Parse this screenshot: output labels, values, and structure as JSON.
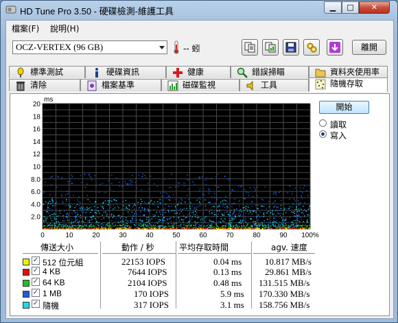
{
  "window": {
    "title": "HD Tune Pro 3.50 - 硬碟檢測-維護工具"
  },
  "menu": [
    {
      "label": "檔案(F)"
    },
    {
      "label": "說明(H)"
    }
  ],
  "toolbar": {
    "drive": "OCZ-VERTEX (96 GB)",
    "temperature": "-- 蚓",
    "exit_label": "離開",
    "buttons": [
      "copy-text-icon",
      "copy-image-icon",
      "save-icon",
      "options-icon",
      "download-icon"
    ]
  },
  "tabs_row1": [
    {
      "label": "標準測試",
      "icon": "benchmark-icon"
    },
    {
      "label": "硬碟資訊",
      "icon": "info-icon"
    },
    {
      "label": "健康",
      "icon": "health-icon"
    },
    {
      "label": "錯誤掃瞄",
      "icon": "error-scan-icon"
    },
    {
      "label": "資料夾使用率",
      "icon": "folder-icon"
    }
  ],
  "tabs_row2": [
    {
      "label": "清除",
      "icon": "erase-icon"
    },
    {
      "label": "檔案基準",
      "icon": "file-benchmark-icon"
    },
    {
      "label": "磁碟監視",
      "icon": "disk-monitor-icon"
    },
    {
      "label": "工具",
      "icon": "tools-icon"
    },
    {
      "label": "隨機存取",
      "icon": "random-access-icon",
      "active": true
    }
  ],
  "controls": {
    "start_label": "開始",
    "read_label": "讀取",
    "write_label": "寫入",
    "mode_selected": "write"
  },
  "chart_data": {
    "type": "scatter",
    "ylabel": "ms",
    "xlabel": "",
    "ylim": [
      0,
      20
    ],
    "xlim": [
      0,
      100
    ],
    "yticks": [
      2.0,
      4.0,
      6.0,
      8.0,
      10,
      12,
      14,
      16,
      18,
      20
    ],
    "xticks": [
      "0",
      "10",
      "20",
      "30",
      "40",
      "50",
      "60",
      "70",
      "80",
      "90",
      "100%"
    ],
    "grid": true,
    "background": "#000000",
    "series": [
      {
        "name": "512 位元組",
        "color": "#f0f000",
        "approx_latency_ms": 0.04
      },
      {
        "name": "4 KB",
        "color": "#e01010",
        "approx_latency_ms": 0.13
      },
      {
        "name": "64 KB",
        "color": "#20c020",
        "approx_latency_ms": 0.48
      },
      {
        "name": "1 MB",
        "color": "#1e5fd8",
        "approx_latency_ms": 5.9
      },
      {
        "name": "隨機",
        "color": "#20d8e8",
        "approx_latency_ms": 3.1
      }
    ]
  },
  "table": {
    "headers": [
      "傳送大小",
      "動作 / 秒",
      "平均存取時間",
      "agv. 速度"
    ],
    "rows": [
      {
        "size": "512 位元組",
        "iops": "22153 IOPS",
        "access": "0.04 ms",
        "speed": "10.817 MB/s",
        "color": "#f0f000"
      },
      {
        "size": "4 KB",
        "iops": "7644 IOPS",
        "access": "0.13 ms",
        "speed": "29.861 MB/s",
        "color": "#e01010"
      },
      {
        "size": "64 KB",
        "iops": "2104 IOPS",
        "access": "0.48 ms",
        "speed": "131.515 MB/s",
        "color": "#20c020"
      },
      {
        "size": "1 MB",
        "iops": "170 IOPS",
        "access": "5.9 ms",
        "speed": "170.330 MB/s",
        "color": "#1e5fd8"
      },
      {
        "size": "隨機",
        "iops": "317 IOPS",
        "access": "3.1 ms",
        "speed": "158.756 MB/s",
        "color": "#20d8e8"
      }
    ]
  }
}
